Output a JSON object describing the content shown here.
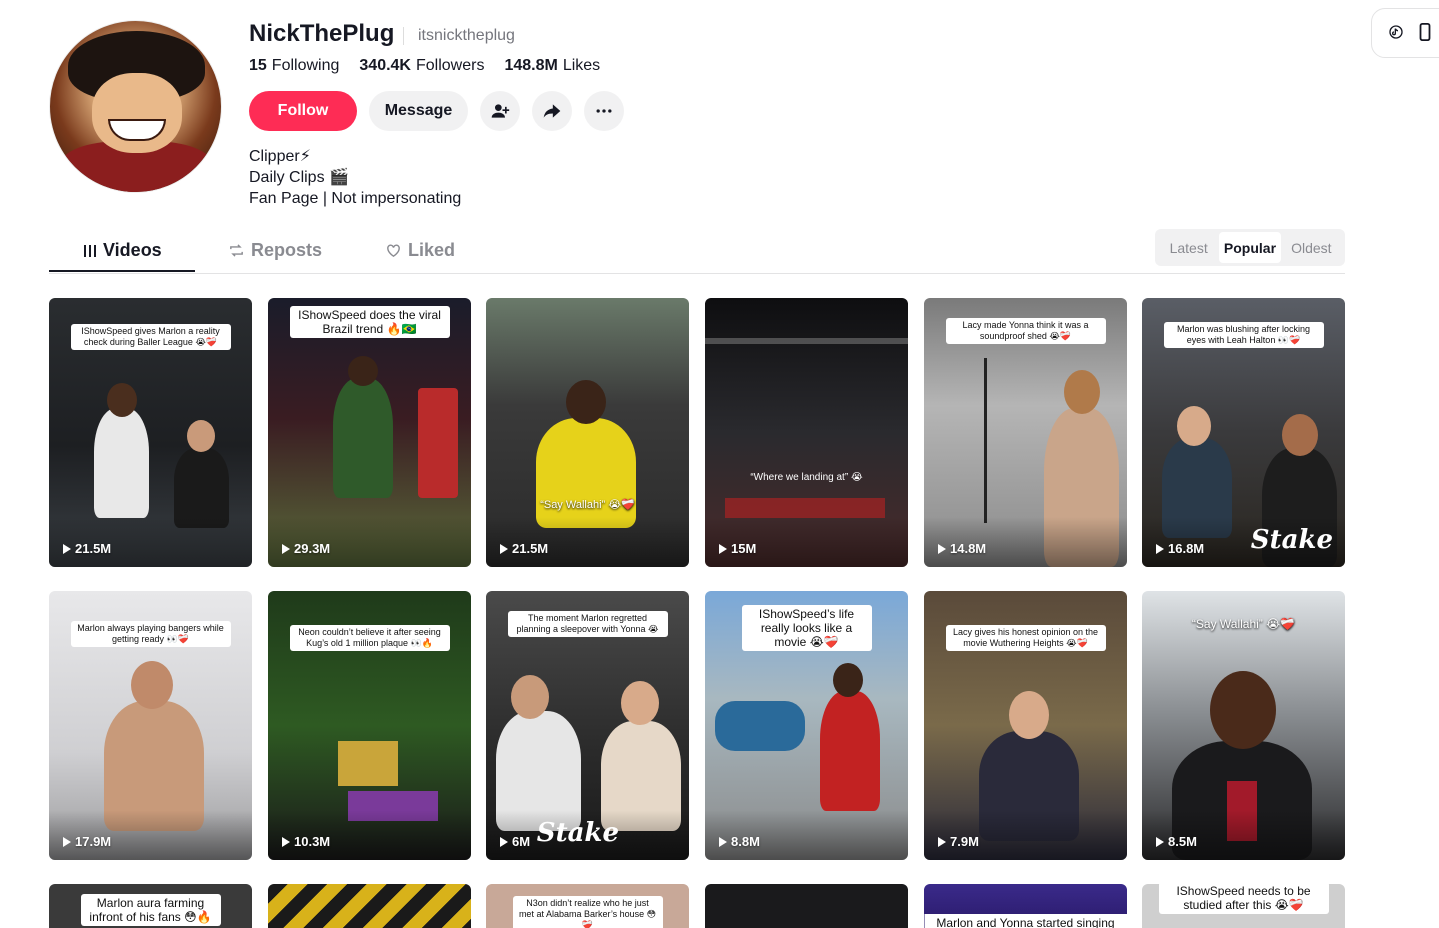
{
  "profile": {
    "name": "NickThePlug",
    "handle": "itsnicktheplug",
    "following_count": "15",
    "following_label": "Following",
    "followers_count": "340.4K",
    "followers_label": "Followers",
    "likes_count": "148.8M",
    "likes_label": "Likes",
    "bio_lines": [
      "Clipper⚡",
      "Daily Clips 🎬",
      "Fan Page | Not impersonating"
    ]
  },
  "actions": {
    "follow_label": "Follow",
    "message_label": "Message"
  },
  "tabs": [
    {
      "label": "Videos",
      "icon": "grid-icon",
      "active": true
    },
    {
      "label": "Reposts",
      "icon": "repost-icon",
      "active": false
    },
    {
      "label": "Liked",
      "icon": "heart-icon",
      "active": false
    }
  ],
  "sort": {
    "options": [
      "Latest",
      "Popular",
      "Oldest"
    ],
    "selected": "Popular"
  },
  "videos": [
    {
      "caption": "IShowSpeed gives Marlon a reality check during Baller League 😭❤️‍🩹",
      "views": "21.5M"
    },
    {
      "caption": "IShowSpeed does the viral Brazil trend 🔥🇧🇷",
      "views": "29.3M"
    },
    {
      "caption": "“Say Wallahi” 😭❤️‍🩹",
      "views": "21.5M"
    },
    {
      "caption": "“Where we landing at” 😭",
      "views": "15M"
    },
    {
      "caption": "Lacy made Yonna think it was a soundproof shed 😭❤️‍🩹",
      "views": "14.8M"
    },
    {
      "caption": "Marlon was blushing after locking eyes with Leah Halton 👀❤️‍🩹",
      "views": "16.8M",
      "overlay": "Stake"
    },
    {
      "caption": "Marlon always playing bangers while getting ready 👀❤️‍🩹",
      "views": "17.9M"
    },
    {
      "caption": "Neon couldn’t believe it after seeing Kug’s old 1 million plaque 👀🔥",
      "views": "10.3M"
    },
    {
      "caption": "The moment Marlon regretted planning a sleepover with Yonna 😭",
      "views": "6M",
      "overlay": "Stake"
    },
    {
      "caption": "IShowSpeed’s life really looks like a movie 😭❤️‍🩹",
      "views": "8.8M"
    },
    {
      "caption": "Lacy gives his honest opinion on the movie Wuthering Heights 😭❤️‍🩹",
      "views": "7.9M"
    },
    {
      "caption": "“Say Wallahi” 😭❤️‍🩹",
      "views": "8.5M"
    },
    {
      "caption": "Marlon aura farming infront of his fans 😳🔥",
      "views": ""
    },
    {
      "caption": "",
      "views": ""
    },
    {
      "caption": "N3on didn’t realize who he just met at Alabama Barker’s house 😳❤️‍🩹",
      "views": ""
    },
    {
      "caption": "",
      "views": ""
    },
    {
      "caption": "Marlon and Yonna started singing and",
      "views": ""
    },
    {
      "caption": "IShowSpeed needs to be studied after this 😭❤️‍🩹",
      "views": ""
    }
  ]
}
